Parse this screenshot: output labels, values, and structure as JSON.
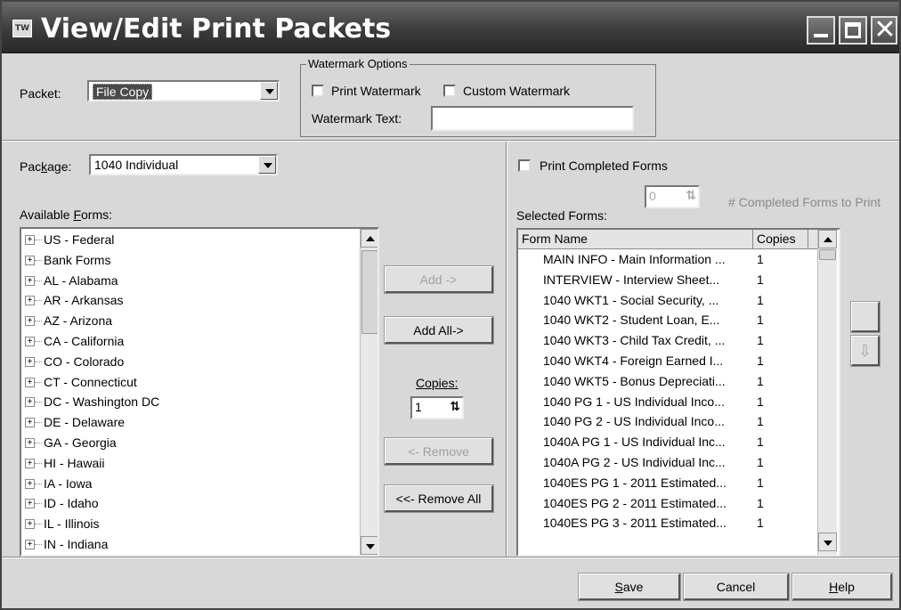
{
  "window": {
    "title": "View/Edit Print Packets",
    "app_icon_text": "TW"
  },
  "packet": {
    "label": "Packet:",
    "value": "File Copy"
  },
  "watermark": {
    "group_label": "Watermark Options",
    "print_label": "Print Watermark",
    "print_checked": false,
    "custom_label": "Custom Watermark",
    "custom_checked": false,
    "text_label": "Watermark Text:",
    "text_value": ""
  },
  "package": {
    "label_pre": "Pac",
    "label_u": "k",
    "label_post": "age:",
    "value": "1040 Individual"
  },
  "available": {
    "label_pre": "Available ",
    "label_u": "F",
    "label_post": "orms:",
    "items": [
      "US - Federal",
      "Bank Forms",
      "AL - Alabama",
      "AR - Arkansas",
      "AZ - Arizona",
      "CA - California",
      "CO - Colorado",
      "CT - Connecticut",
      "DC - Washington DC",
      "DE - Delaware",
      "GA - Georgia",
      "HI - Hawaii",
      "IA - Iowa",
      "ID - Idaho",
      "IL - Illinois",
      "IN - Indiana"
    ]
  },
  "buttons": {
    "add": "Add ->",
    "add_all": "Add All->",
    "remove": "<- Remove",
    "remove_all": "<<- Remove All"
  },
  "copies": {
    "label": "Copies:",
    "value": "1"
  },
  "completed": {
    "print_label": "Print Completed Forms",
    "print_checked": false,
    "count_value": "0",
    "count_label": "# Completed Forms to Print"
  },
  "selected": {
    "label": "Selected Forms:",
    "columns": [
      "Form Name",
      "Copies"
    ],
    "rows": [
      {
        "name": "MAIN INFO - Main Information ...",
        "copies": "1"
      },
      {
        "name": "INTERVIEW - Interview Sheet...",
        "copies": "1"
      },
      {
        "name": "1040 WKT1 - Social Security, ...",
        "copies": "1"
      },
      {
        "name": "1040 WKT2 - Student Loan, E...",
        "copies": "1"
      },
      {
        "name": "1040 WKT3 - Child Tax Credit, ...",
        "copies": "1"
      },
      {
        "name": "1040 WKT4 - Foreign Earned I...",
        "copies": "1"
      },
      {
        "name": "1040 WKT5 - Bonus Depreciati...",
        "copies": "1"
      },
      {
        "name": "1040 PG 1 - US Individual Inco...",
        "copies": "1"
      },
      {
        "name": "1040 PG 2 - US Individual Inco...",
        "copies": "1"
      },
      {
        "name": "1040A PG 1 - US Individual Inc...",
        "copies": "1"
      },
      {
        "name": "1040A PG 2 - US Individual Inc...",
        "copies": "1"
      },
      {
        "name": "1040ES PG 1 - 2011 Estimated...",
        "copies": "1"
      },
      {
        "name": "1040ES PG 2 - 2011 Estimated...",
        "copies": "1"
      },
      {
        "name": "1040ES PG 3 - 2011 Estimated...",
        "copies": "1"
      }
    ]
  },
  "footer": {
    "save_u": "S",
    "save_post": "ave",
    "cancel": "Cancel",
    "help_u": "H",
    "help_post": "elp"
  }
}
